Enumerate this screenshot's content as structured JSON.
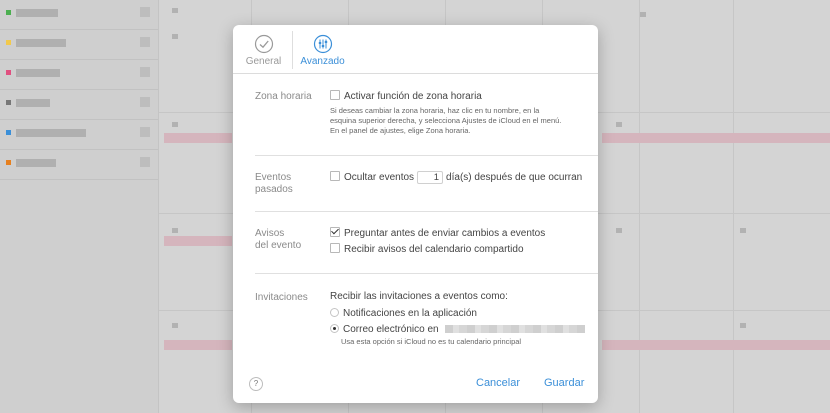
{
  "sidebar": {
    "calendars": [
      {
        "color": "#4caf50",
        "width": 42
      },
      {
        "color": "#f2c94c",
        "width": 50
      },
      {
        "color": "#e05080",
        "width": 44
      },
      {
        "color": "#777777",
        "width": 34
      },
      {
        "color": "#3b8fd8",
        "width": 70
      },
      {
        "color": "#e6801f",
        "width": 40
      }
    ]
  },
  "tabs": {
    "general": "General",
    "advanced": "Avanzado"
  },
  "timezone": {
    "label": "Zona horaria",
    "checkbox_label": "Activar función de zona horaria",
    "checked": false,
    "note_1": "Si deseas cambiar la zona horaria, haz clic en tu nombre, en la",
    "note_2": "esquina superior derecha, y selecciona Ajustes de iCloud en el menú.",
    "note_3": "En el panel de ajustes, elige Zona horaria."
  },
  "past_events": {
    "label_1": "Eventos",
    "label_2": "pasados",
    "checkbox_label": "Ocultar eventos",
    "days_value": "1",
    "suffix": "día(s) después de que ocurran",
    "checked": false
  },
  "event_alerts": {
    "label_1": "Avisos",
    "label_2": "del evento",
    "option_1": "Preguntar antes de enviar cambios a eventos",
    "option_1_checked": true,
    "option_2": "Recibir avisos del calendario compartido",
    "option_2_checked": false
  },
  "invitations": {
    "label": "Invitaciones",
    "heading": "Recibir las invitaciones a eventos como:",
    "option_1": "Notificaciones en la aplicación",
    "option_2": "Correo electrónico en",
    "selected": "option_2",
    "note": "Usa esta opción si iCloud no es tu calendario principal"
  },
  "footer": {
    "help": "?",
    "cancel": "Cancelar",
    "save": "Guardar"
  },
  "colors": {
    "accent": "#3b8fd8",
    "event_pink": "#d5b5bd"
  }
}
